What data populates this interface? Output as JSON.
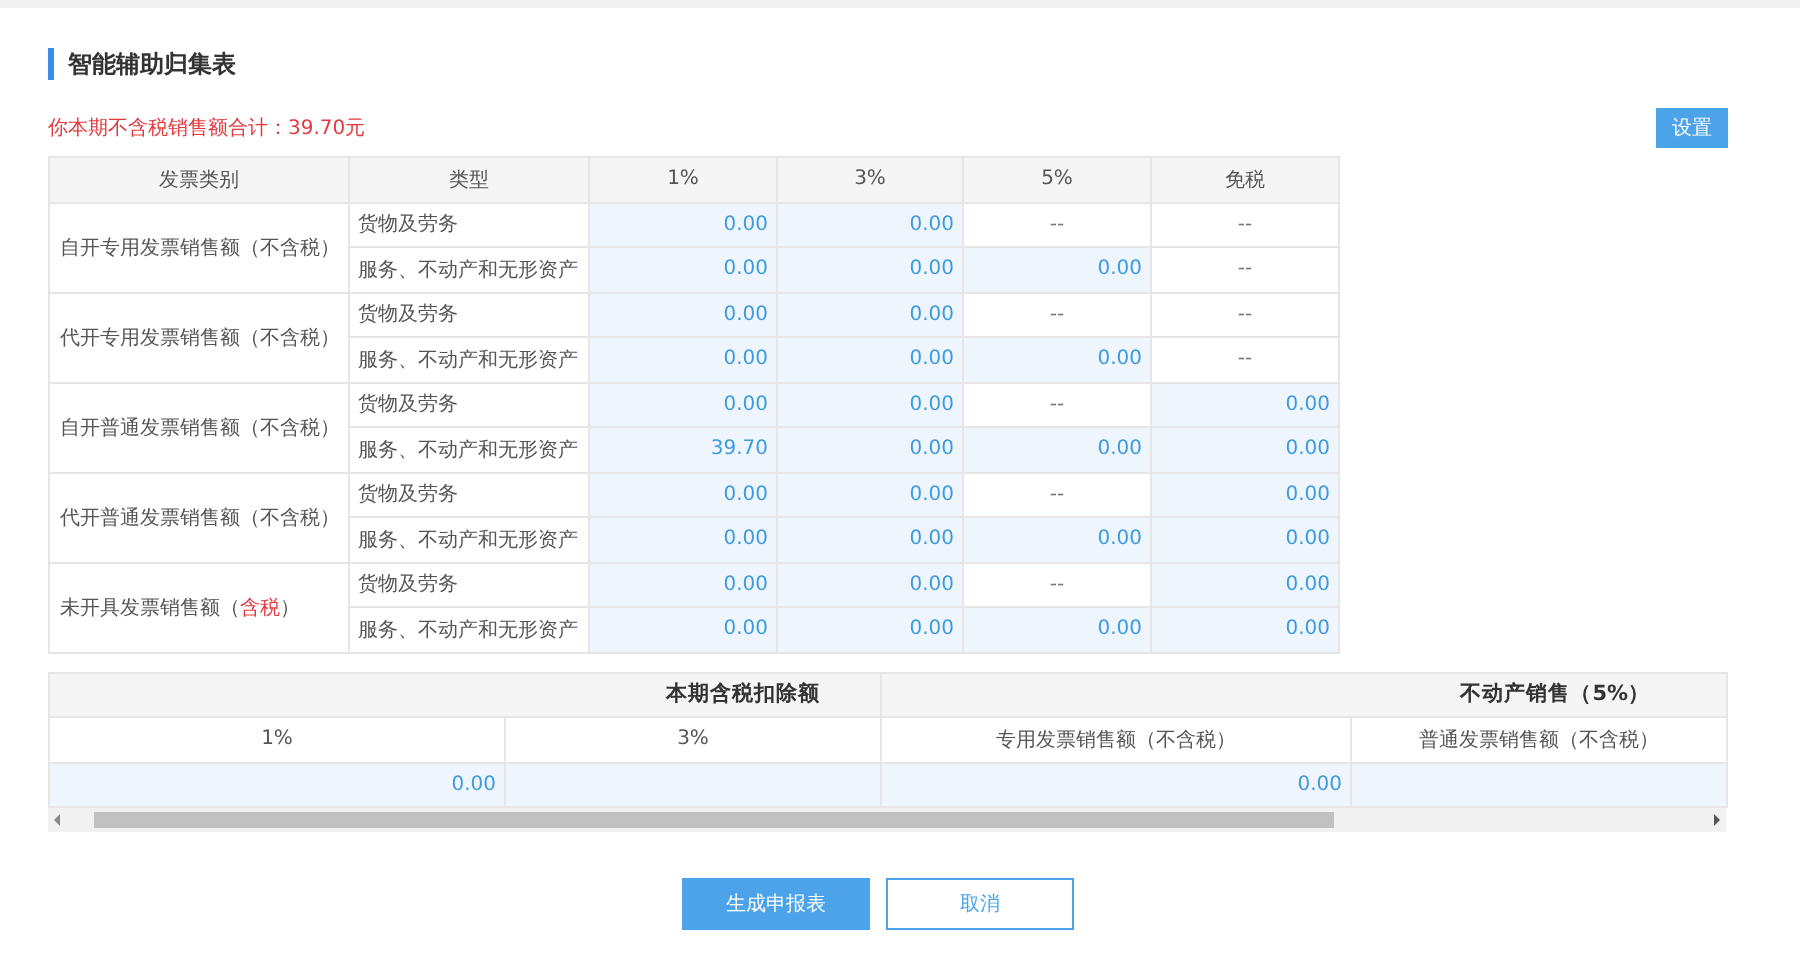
{
  "title": "智能辅助归集表",
  "summary": "你本期不含税销售额合计：39.70元",
  "settings_button": "设置",
  "table": {
    "columns": [
      "发票类别",
      "类型",
      "1%",
      "3%",
      "5%",
      "免税"
    ],
    "groups": [
      {
        "label": [
          {
            "text": "自开专用发票销售额（不含税）",
            "kind": "plain"
          }
        ],
        "rows": [
          {
            "type": "货物及劳务",
            "cells": [
              {
                "value": "0.00",
                "kind": "input"
              },
              {
                "value": "0.00",
                "kind": "input"
              },
              {
                "value": "--",
                "kind": "na"
              },
              {
                "value": "--",
                "kind": "na"
              }
            ]
          },
          {
            "type": "服务、不动产和无形资产",
            "cells": [
              {
                "value": "0.00",
                "kind": "input"
              },
              {
                "value": "0.00",
                "kind": "input"
              },
              {
                "value": "0.00",
                "kind": "input"
              },
              {
                "value": "--",
                "kind": "na"
              }
            ]
          }
        ]
      },
      {
        "label": [
          {
            "text": "代开专用发票销售额（不含税）",
            "kind": "plain"
          }
        ],
        "rows": [
          {
            "type": "货物及劳务",
            "cells": [
              {
                "value": "0.00",
                "kind": "input"
              },
              {
                "value": "0.00",
                "kind": "input"
              },
              {
                "value": "--",
                "kind": "na"
              },
              {
                "value": "--",
                "kind": "na"
              }
            ]
          },
          {
            "type": "服务、不动产和无形资产",
            "cells": [
              {
                "value": "0.00",
                "kind": "input"
              },
              {
                "value": "0.00",
                "kind": "input"
              },
              {
                "value": "0.00",
                "kind": "input"
              },
              {
                "value": "--",
                "kind": "na"
              }
            ]
          }
        ]
      },
      {
        "label": [
          {
            "text": "自开普通发票销售额（不含税）",
            "kind": "plain"
          }
        ],
        "rows": [
          {
            "type": "货物及劳务",
            "cells": [
              {
                "value": "0.00",
                "kind": "input"
              },
              {
                "value": "0.00",
                "kind": "input"
              },
              {
                "value": "--",
                "kind": "na"
              },
              {
                "value": "0.00",
                "kind": "input"
              }
            ]
          },
          {
            "type": "服务、不动产和无形资产",
            "cells": [
              {
                "value": "39.70",
                "kind": "input"
              },
              {
                "value": "0.00",
                "kind": "input"
              },
              {
                "value": "0.00",
                "kind": "input"
              },
              {
                "value": "0.00",
                "kind": "input"
              }
            ]
          }
        ]
      },
      {
        "label": [
          {
            "text": "代开普通发票销售额（不含税）",
            "kind": "plain"
          }
        ],
        "rows": [
          {
            "type": "货物及劳务",
            "cells": [
              {
                "value": "0.00",
                "kind": "input"
              },
              {
                "value": "0.00",
                "kind": "input"
              },
              {
                "value": "--",
                "kind": "na"
              },
              {
                "value": "0.00",
                "kind": "input"
              }
            ]
          },
          {
            "type": "服务、不动产和无形资产",
            "cells": [
              {
                "value": "0.00",
                "kind": "input"
              },
              {
                "value": "0.00",
                "kind": "input"
              },
              {
                "value": "0.00",
                "kind": "input"
              },
              {
                "value": "0.00",
                "kind": "input"
              }
            ]
          }
        ]
      },
      {
        "label": [
          {
            "text": "未开具发票销售额（",
            "kind": "plain"
          },
          {
            "text": "含税",
            "kind": "warning"
          },
          {
            "text": "）",
            "kind": "plain"
          }
        ],
        "rows": [
          {
            "type": "货物及劳务",
            "cells": [
              {
                "value": "0.00",
                "kind": "input"
              },
              {
                "value": "0.00",
                "kind": "input"
              },
              {
                "value": "--",
                "kind": "na"
              },
              {
                "value": "0.00",
                "kind": "input"
              }
            ]
          },
          {
            "type": "服务、不动产和无形资产",
            "cells": [
              {
                "value": "0.00",
                "kind": "input"
              },
              {
                "value": "0.00",
                "kind": "input"
              },
              {
                "value": "0.00",
                "kind": "input"
              },
              {
                "value": "0.00",
                "kind": "input"
              }
            ]
          }
        ]
      }
    ]
  },
  "deduction_table": {
    "groups": [
      "本期含税扣除额",
      "不动产销售（5%）"
    ],
    "columns": [
      "1%",
      "3%",
      "专用发票销售额（不含税）",
      "普通发票销售额（不含税）"
    ],
    "cells": [
      {
        "value": "0.00",
        "kind": "input"
      },
      {
        "kind": "input"
      },
      {
        "value": "0.00",
        "kind": "input"
      },
      {
        "kind": "input"
      }
    ]
  },
  "buttons": [
    {
      "label": "生成申报表",
      "kind": "primary"
    },
    {
      "label": "取消",
      "kind": "secondary"
    }
  ]
}
